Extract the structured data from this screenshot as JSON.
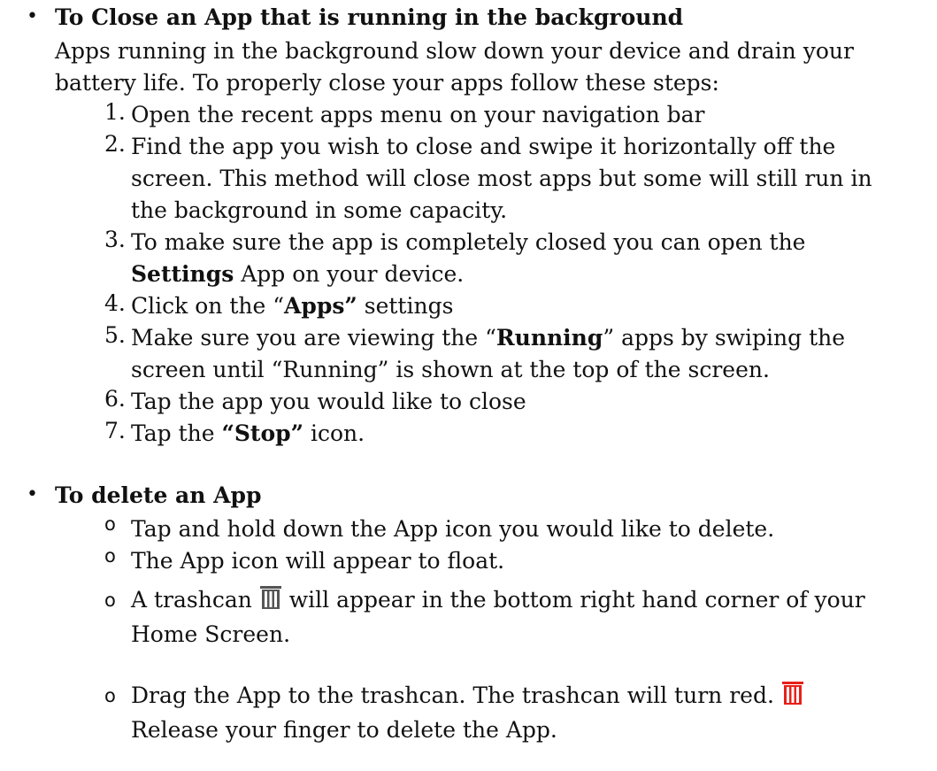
{
  "section1": {
    "heading": "To Close an App that is running in the background",
    "intro": "Apps running in the background slow down your device and drain your battery life. To properly close your apps follow these steps:",
    "steps": [
      {
        "num": "1.",
        "text": "Open the recent apps menu on your navigation bar"
      },
      {
        "num": "2.",
        "text": "Find the app you wish to close and swipe it horizontally off the screen. This method will close most apps but some will still run in the background in some capacity."
      },
      {
        "num": "3.",
        "pre": "To make sure the app is completely closed you can open the ",
        "bold": "Settings",
        "post": " App on your device."
      },
      {
        "num": "4.",
        "pre": "Click on the “",
        "bold": "Apps”",
        "post": " settings"
      },
      {
        "num": "5.",
        "pre": "Make sure you are viewing the “",
        "bold": "Running",
        "post": "” apps by swiping the screen until “Running” is shown at the top of the screen."
      },
      {
        "num": "6.",
        "text": "Tap the app you would like to close"
      },
      {
        "num": "7.",
        "pre": "Tap the ",
        "bold": "“Stop”",
        "post": " icon."
      }
    ]
  },
  "section2": {
    "heading": "To delete an App",
    "items": [
      {
        "mark": "o",
        "text": "Tap and hold down the App icon you would like to delete."
      },
      {
        "mark": "o",
        "text": "The App icon will appear to float."
      },
      {
        "mark": "o",
        "pre": "A trashcan ",
        "post": " will appear in the bottom right hand corner of your Home Screen.",
        "icon": "trashcan-gray-icon"
      },
      {
        "mark": "o",
        "pre": "Drag the App to the trashcan. The trashcan will turn red. ",
        "post": "Release your finger to delete the App.",
        "icon": "trashcan-red-icon"
      }
    ]
  },
  "colors": {
    "text": "#111111",
    "trash_gray": "#555555",
    "trash_red": "#e8201a"
  }
}
